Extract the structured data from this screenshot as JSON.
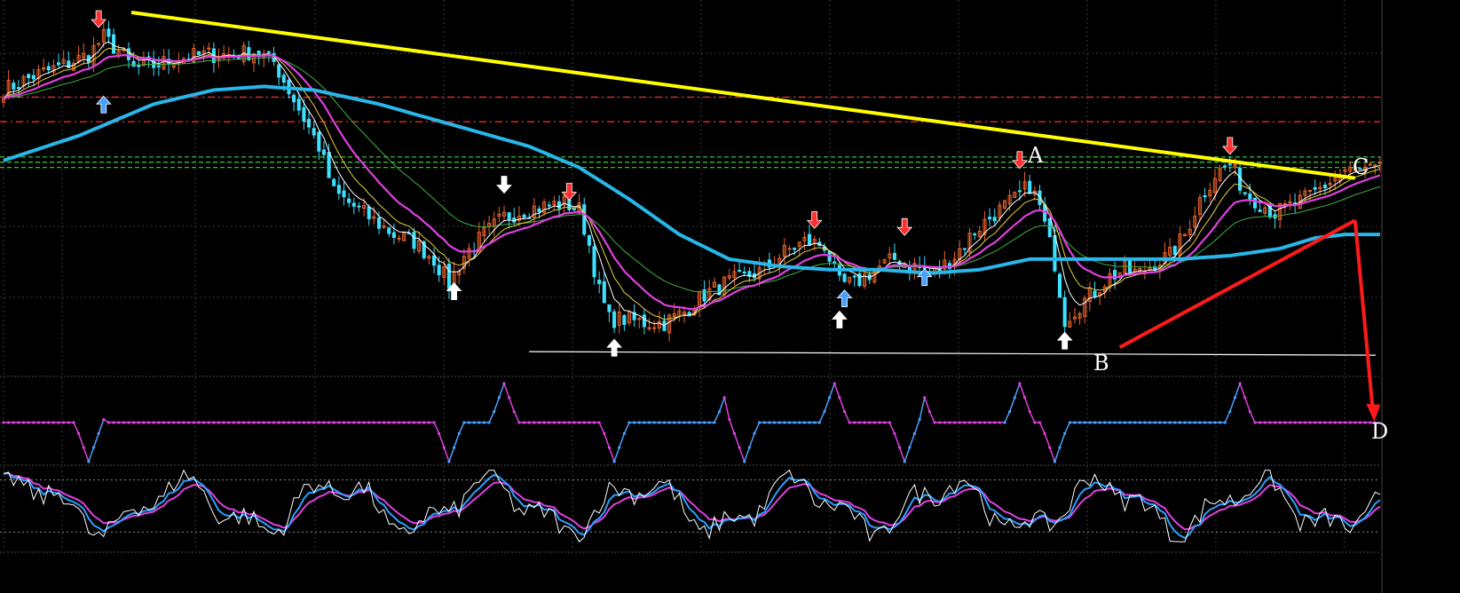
{
  "chart_data": {
    "type": "line",
    "subtype": "candlestick-technical",
    "annotations": [
      "A",
      "B",
      "C",
      "D"
    ],
    "colors": {
      "background": "#000000",
      "grid": "#3a3a3a",
      "trend_upper": "#ffff00",
      "trend_lower": "#ff1a1a",
      "forecast_arrow": "#ff1a1a",
      "support": "#ffffff",
      "ma_long": "#29b6e8",
      "ma_mid": "#e040e0",
      "ma_fast": "#e8d040",
      "ma_fastest": "#ffffff",
      "ma_green": "#40b040",
      "candle_up": "#e8622a",
      "candle_down": "#3ee0ff",
      "res_red": "#ff3030",
      "res_green": "#40d040",
      "osc1_up": "#4aa0ff",
      "osc1_down": "#e040e0",
      "osc2_main": "#ffffff",
      "osc2_sig1": "#29a0ff",
      "osc2_sig2": "#e040e0"
    },
    "price_panel": {
      "ylim": [
        0,
        100
      ],
      "resistance_levels": [
        {
          "value": 77,
          "color": "red"
        },
        {
          "value": 70,
          "color": "red"
        },
        {
          "value": 60,
          "color": "green"
        },
        {
          "value": 58.5,
          "color": "green"
        },
        {
          "value": 57,
          "color": "green"
        }
      ],
      "support_level": 4,
      "trend_upper": {
        "from": [
          0,
          101
        ],
        "to": [
          270,
          54
        ]
      },
      "trend_lower": {
        "from": [
          223,
          6
        ],
        "to": [
          270,
          42
        ]
      },
      "forecast": {
        "from": [
          270,
          42
        ],
        "to": [
          274,
          -6
        ]
      },
      "pivots": [
        {
          "label": "A",
          "x": 204,
          "y": 56
        },
        {
          "label": "B",
          "x": 213,
          "y": 9
        },
        {
          "label": "C",
          "x": 267,
          "y": 56
        },
        {
          "label": "D",
          "x": 274,
          "y": -6
        }
      ],
      "signal_arrows": [
        {
          "x": 20,
          "dir": "up",
          "color": "blue",
          "y": 75
        },
        {
          "x": 19,
          "dir": "down",
          "color": "red",
          "y": 99
        },
        {
          "x": 90,
          "dir": "up",
          "color": "white",
          "y": 22
        },
        {
          "x": 100,
          "dir": "down",
          "color": "white",
          "y": 52
        },
        {
          "x": 113,
          "dir": "down",
          "color": "red",
          "y": 50
        },
        {
          "x": 122,
          "dir": "up",
          "color": "white",
          "y": 6
        },
        {
          "x": 162,
          "dir": "down",
          "color": "red",
          "y": 42
        },
        {
          "x": 168,
          "dir": "up",
          "color": "blue",
          "y": 20
        },
        {
          "x": 167,
          "dir": "up",
          "color": "white",
          "y": 14
        },
        {
          "x": 180,
          "dir": "down",
          "color": "red",
          "y": 40
        },
        {
          "x": 184,
          "dir": "up",
          "color": "blue",
          "y": 26
        },
        {
          "x": 203,
          "dir": "down",
          "color": "red",
          "y": 59
        },
        {
          "x": 212,
          "dir": "up",
          "color": "white",
          "y": 8
        },
        {
          "x": 245,
          "dir": "down",
          "color": "red",
          "y": 63
        }
      ],
      "close_knots": [
        [
          0,
          79
        ],
        [
          6,
          83
        ],
        [
          12,
          86
        ],
        [
          17,
          89
        ],
        [
          20,
          94
        ],
        [
          23,
          90
        ],
        [
          26,
          85
        ],
        [
          30,
          86
        ],
        [
          35,
          88
        ],
        [
          40,
          89
        ],
        [
          45,
          89
        ],
        [
          50,
          90
        ],
        [
          54,
          87
        ],
        [
          57,
          79
        ],
        [
          60,
          71
        ],
        [
          63,
          63
        ],
        [
          66,
          50
        ],
        [
          70,
          46
        ],
        [
          74,
          42
        ],
        [
          78,
          38
        ],
        [
          82,
          36
        ],
        [
          86,
          31
        ],
        [
          89,
          24
        ],
        [
          92,
          32
        ],
        [
          96,
          38
        ],
        [
          100,
          43
        ],
        [
          104,
          45
        ],
        [
          108,
          46
        ],
        [
          112,
          47
        ],
        [
          115,
          45
        ],
        [
          117,
          35
        ],
        [
          119,
          22
        ],
        [
          121,
          14
        ],
        [
          124,
          14
        ],
        [
          128,
          13
        ],
        [
          132,
          13
        ],
        [
          136,
          16
        ],
        [
          140,
          21
        ],
        [
          144,
          24
        ],
        [
          148,
          26
        ],
        [
          152,
          28
        ],
        [
          156,
          33
        ],
        [
          160,
          36
        ],
        [
          164,
          35
        ],
        [
          167,
          24
        ],
        [
          170,
          24
        ],
        [
          174,
          28
        ],
        [
          178,
          31
        ],
        [
          182,
          29
        ],
        [
          186,
          27
        ],
        [
          190,
          32
        ],
        [
          194,
          39
        ],
        [
          198,
          44
        ],
        [
          202,
          48
        ],
        [
          205,
          52
        ],
        [
          207,
          46
        ],
        [
          210,
          30
        ],
        [
          212,
          14
        ],
        [
          215,
          18
        ],
        [
          218,
          22
        ],
        [
          221,
          26
        ],
        [
          224,
          28
        ],
        [
          227,
          27
        ],
        [
          230,
          30
        ],
        [
          233,
          32
        ],
        [
          236,
          38
        ],
        [
          239,
          48
        ],
        [
          242,
          55
        ],
        [
          245,
          58
        ],
        [
          248,
          50
        ],
        [
          251,
          47
        ],
        [
          254,
          44
        ],
        [
          257,
          46
        ],
        [
          260,
          48
        ],
        [
          263,
          51
        ],
        [
          266,
          54
        ],
        [
          268,
          56
        ]
      ],
      "ma_long_knots": [
        [
          0,
          59
        ],
        [
          15,
          66
        ],
        [
          30,
          75
        ],
        [
          42,
          79
        ],
        [
          52,
          80
        ],
        [
          62,
          79
        ],
        [
          75,
          75
        ],
        [
          90,
          69
        ],
        [
          105,
          63
        ],
        [
          115,
          57
        ],
        [
          125,
          48
        ],
        [
          135,
          38
        ],
        [
          145,
          31
        ],
        [
          155,
          29
        ],
        [
          165,
          28
        ],
        [
          175,
          28
        ],
        [
          185,
          27
        ],
        [
          195,
          28
        ],
        [
          205,
          31
        ],
        [
          215,
          31
        ],
        [
          225,
          31
        ],
        [
          235,
          31
        ],
        [
          245,
          32
        ],
        [
          255,
          34
        ],
        [
          262,
          37
        ],
        [
          268,
          38
        ]
      ]
    },
    "osc1": {
      "ylim": [
        0,
        100
      ],
      "baseline": 50,
      "peaks": [
        18,
        100,
        145,
        166,
        183,
        203,
        247
      ],
      "troughs": [
        17,
        89,
        122,
        148,
        180,
        210
      ]
    },
    "osc2": {
      "ylim": [
        0,
        100
      ],
      "levels": [
        85,
        15
      ]
    }
  }
}
